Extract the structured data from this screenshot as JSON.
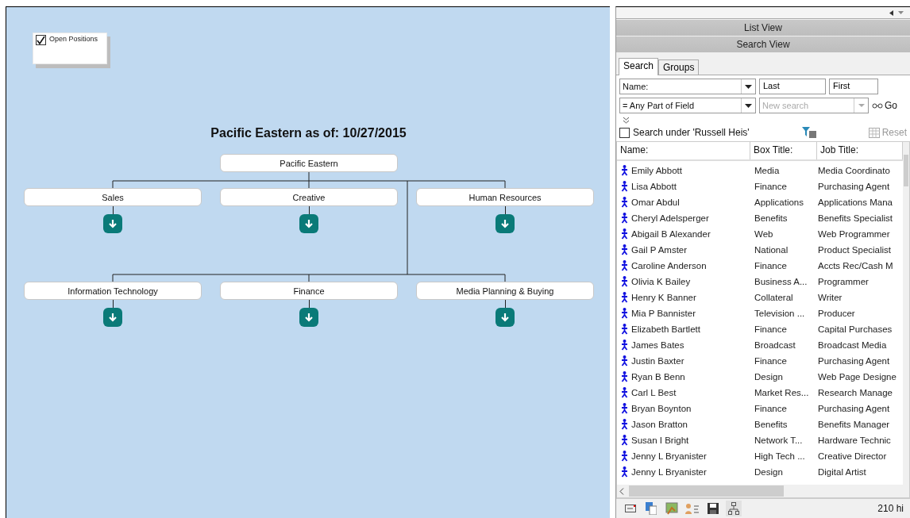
{
  "legend": {
    "label": "Open Positions",
    "checked": true
  },
  "chart": {
    "title": "Pacific Eastern as of: 10/27/2015",
    "root": "Pacific Eastern",
    "departments": [
      {
        "name": "Sales"
      },
      {
        "name": "Creative"
      },
      {
        "name": "Human Resources"
      },
      {
        "name": "Information Technology"
      },
      {
        "name": "Finance"
      },
      {
        "name": "Media Planning & Buying"
      }
    ]
  },
  "panel_headers": [
    "List View",
    "Search View"
  ],
  "tabs": [
    {
      "label": "Search",
      "selected": true
    },
    {
      "label": "Groups",
      "selected": false
    }
  ],
  "search": {
    "field": "Name:",
    "last": "Last",
    "first": "First",
    "match": "= Any Part of Field",
    "query_placeholder": "New search",
    "go": "Go",
    "scope": {
      "label": "Search under 'Russell Heis'",
      "checked": false
    },
    "reset": "Reset"
  },
  "columns": [
    "Name:",
    "Box Title:",
    "Job Title:"
  ],
  "rows": [
    {
      "name": "Emily  Abbott",
      "box": "Media",
      "job": "Media Coordinato"
    },
    {
      "name": "Lisa  Abbott",
      "box": "Finance",
      "job": "Purchasing Agent"
    },
    {
      "name": "Omar  Abdul",
      "box": "Applications",
      "job": "Applications Mana"
    },
    {
      "name": "Cheryl  Adelsperger",
      "box": "Benefits",
      "job": "Benefits Specialist"
    },
    {
      "name": "Abigail B Alexander",
      "box": "Web",
      "job": "Web Programmer"
    },
    {
      "name": "Gail P Amster",
      "box": "National",
      "job": "Product Specialist"
    },
    {
      "name": "Caroline  Anderson",
      "box": "Finance",
      "job": "Accts Rec/Cash M"
    },
    {
      "name": "Olivia K Bailey",
      "box": "Business A...",
      "job": "Programmer"
    },
    {
      "name": "Henry K Banner",
      "box": "Collateral",
      "job": "Writer"
    },
    {
      "name": "Mia P Bannister",
      "box": "Television ...",
      "job": "Producer"
    },
    {
      "name": "Elizabeth  Bartlett",
      "box": "Finance",
      "job": "Capital Purchases"
    },
    {
      "name": "James  Bates",
      "box": "Broadcast",
      "job": "Broadcast Media"
    },
    {
      "name": "Justin  Baxter",
      "box": "Finance",
      "job": "Purchasing Agent"
    },
    {
      "name": "Ryan B Benn",
      "box": "Design",
      "job": "Web Page Designe"
    },
    {
      "name": "Carl L Best",
      "box": "Market Res...",
      "job": "Research Manage"
    },
    {
      "name": "Bryan  Boynton",
      "box": "Finance",
      "job": "Purchasing Agent"
    },
    {
      "name": "Jason  Bratton",
      "box": "Benefits",
      "job": "Benefits Manager"
    },
    {
      "name": "Susan I Bright",
      "box": "Network T...",
      "job": "Hardware Technic"
    },
    {
      "name": "Jenny L Bryanister",
      "box": "High Tech ...",
      "job": "Creative Director"
    },
    {
      "name": "Jenny L Bryanister",
      "box": "Design",
      "job": "Digital Artist"
    }
  ],
  "status": "210 hi"
}
